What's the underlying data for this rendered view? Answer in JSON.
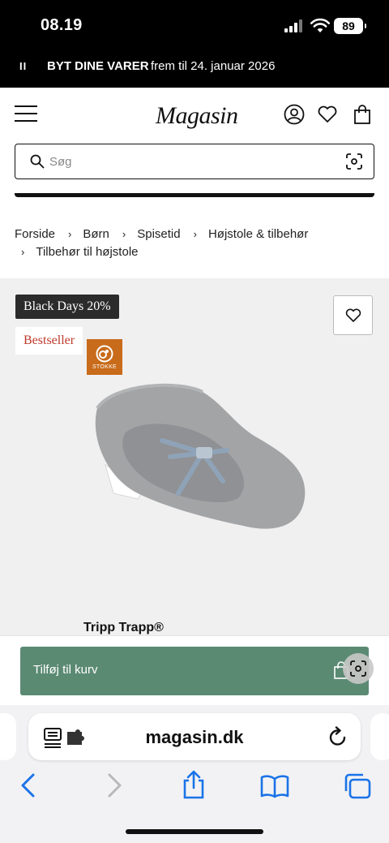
{
  "status": {
    "time": "08.19",
    "battery": "89"
  },
  "promo": {
    "pause": "II",
    "title": "BYT DINE VARER",
    "subtitle": "frem til 24. januar 2026"
  },
  "header": {
    "logo": "Magasin"
  },
  "search": {
    "placeholder": "Søg"
  },
  "breadcrumb": {
    "separator": "›",
    "items": [
      "Forside",
      "Børn",
      "Spisetid",
      "Højstole & tilbehør",
      "Tilbehør til højstole"
    ]
  },
  "product": {
    "badges": {
      "promo": "Black Days 20%",
      "bestseller": "Bestseller"
    },
    "brand_logo_text": "STOKKE",
    "name": "Tripp Trapp®",
    "add_to_cart_label": "Tilføj til kurv"
  },
  "browser": {
    "url": "magasin.dk"
  },
  "colors": {
    "accent_green": "#5b8a73",
    "brand_orange": "#c86b1a",
    "badge_red": "#c0392b"
  }
}
